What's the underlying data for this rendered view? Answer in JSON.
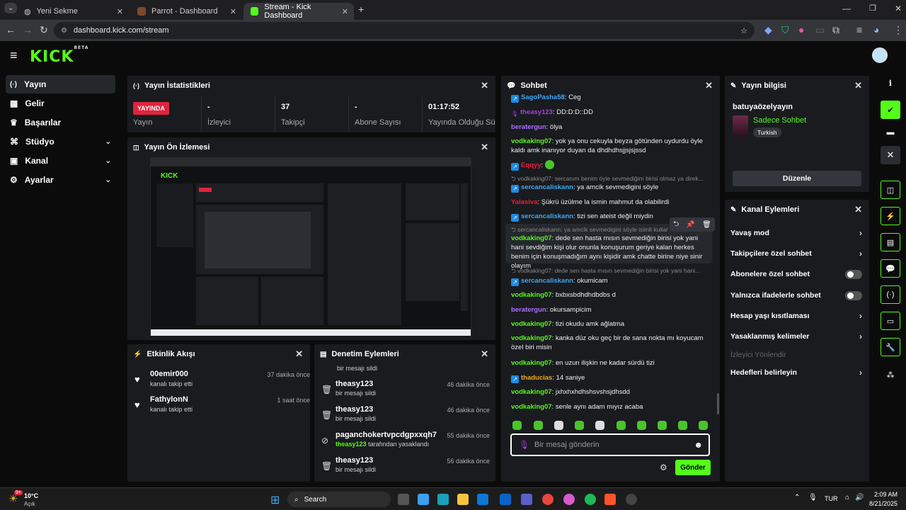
{
  "browser": {
    "tabs": [
      {
        "label": "Yeni Sekme"
      },
      {
        "label": "Parrot - Dashboard"
      },
      {
        "label": "Stream - Kick Dashboard"
      }
    ],
    "url": "dashboard.kick.com/stream"
  },
  "brand": {
    "logo": "KICK",
    "beta": "BETA",
    "accent": "#53fc18"
  },
  "sidebar": {
    "items": [
      {
        "label": "Yayın",
        "icon": "broadcast-icon"
      },
      {
        "label": "Gelir",
        "icon": "revenue-icon"
      },
      {
        "label": "Başarılar",
        "icon": "trophy-icon"
      },
      {
        "label": "Stüdyo",
        "icon": "studio-icon"
      },
      {
        "label": "Kanal",
        "icon": "channel-icon"
      },
      {
        "label": "Ayarlar",
        "icon": "gear-icon"
      }
    ]
  },
  "stats": {
    "title": "Yayın İstatistikleri",
    "live_badge": "YAYINDA",
    "cells": [
      {
        "value": "",
        "label": "Yayın"
      },
      {
        "value": "-",
        "label": "İzleyici"
      },
      {
        "value": "37",
        "label": "Takipçi"
      },
      {
        "value": "-",
        "label": "Abone Sayısı"
      },
      {
        "value": "01:17:52",
        "label": "Yayında Olduğu Süre"
      }
    ]
  },
  "preview": {
    "title": "Yayın Ön İzlemesi"
  },
  "activity": {
    "title": "Etkinlik Akışı",
    "items": [
      {
        "name": "00emir000",
        "sub": "kanalı takip etti",
        "time": "37 dakika önce"
      },
      {
        "name": "FathylonN",
        "sub": "kanalı takip etti",
        "time": "1 saat önce"
      }
    ]
  },
  "moderation": {
    "title": "Denetim Eylemleri",
    "top_sub": "bir mesajı sildi",
    "items": [
      {
        "name": "theasy123",
        "sub": "bir mesajı sildi",
        "time": "46 dakika önce",
        "icon": "trash-icon"
      },
      {
        "name": "theasy123",
        "sub": "bir mesajı sildi",
        "time": "46 dakika önce",
        "icon": "trash-icon"
      },
      {
        "name": "paganchokertvpcdgpxxqh7",
        "sub_user": "theasy123",
        "sub": "tarafından yasaklandı",
        "time": "55 dakika önce",
        "icon": "ban-icon"
      },
      {
        "name": "theasy123",
        "sub": "bir mesajı sildi",
        "time": "56 dakika önce",
        "icon": "trash-icon"
      }
    ]
  },
  "chat": {
    "title": "Sohbet",
    "messages": [
      {
        "user": "SagoPasha58",
        "color": "#3fa9f5",
        "text": "Ceg",
        "badge": "arrow"
      },
      {
        "user": "theasy123",
        "color": "#b03be8",
        "text": "DD:D:D::DD",
        "badge": "mic"
      },
      {
        "user": "beratergun",
        "color": "#a970ff",
        "text": "ölya"
      },
      {
        "user": "vodkaking07",
        "color": "#53fc18",
        "text": "yok ya onu cekuyla beyza götünden uydurdu öyle kaldı amk inanıyor duyan da dhdhdhsjjsjsjssd"
      },
      {
        "user": "Eqqyy",
        "color": "#e0243d",
        "text": "",
        "badge": "arrow"
      },
      {
        "reply": "vodkaking07: sercanım benim öyle sevmediğim birisi olmaz ya direk..."
      },
      {
        "user": "sercancaliskann",
        "color": "#3fa9f5",
        "text": "ya amcik sevmedigini söyle",
        "badge": "arrow"
      },
      {
        "user": "Yalasiva",
        "color": "#e0243d",
        "text": "Şükrü üzülme la ismin mahmut da olabilirdi"
      },
      {
        "user": "sercancaliskann",
        "color": "#3fa9f5",
        "text": "tizi sen ateist değil miydin",
        "badge": "arrow"
      },
      {
        "reply": "sercancaliskann: ya amcik sevmedigini söyle isimli kullanı..."
      },
      {
        "user": "vodkaking07",
        "color": "#53fc18",
        "text": "dede sen hasta mısın sevmediğin birisi yok yani hani sevdiğim kişi olur onunla konuşurum geriye kalan herkes benim için konuşmadığım aynı kişidir amk chatte birine niye sinir olayım"
      },
      {
        "reply": "vodkaking07: dede sen hasta mısın sevmediğin birisi yok yani hani..."
      },
      {
        "user": "sercancaliskann",
        "color": "#3fa9f5",
        "text": "okumicam",
        "badge": "arrow"
      },
      {
        "user": "vodkaking07",
        "color": "#53fc18",
        "text": "bxbxsbdhdhdbdbs d"
      },
      {
        "user": "beratergun",
        "color": "#a970ff",
        "text": "okursampicim"
      },
      {
        "user": "vodkaking07",
        "color": "#53fc18",
        "text": "tizi okudu amk ağlatma"
      },
      {
        "user": "vodkaking07",
        "color": "#53fc18",
        "text": "kanka düz oku geç bir de sana nokta mı koyucam özel biri misin"
      },
      {
        "user": "vodkaking07",
        "color": "#53fc18",
        "text": "en uzun ilişkin ne kadar sürdü tizi"
      },
      {
        "user": "thaducias",
        "color": "#f5a623",
        "text": "14 saniye",
        "badge": "arrow"
      },
      {
        "user": "vodkaking07",
        "color": "#53fc18",
        "text": "jxhxhxhdhshsvshsjdhsdd"
      },
      {
        "user": "vodkaking07",
        "color": "#53fc18",
        "text": "senle aynı adam mıyız acaba"
      }
    ],
    "placeholder": "Bir mesaj gönderin",
    "send_label": "Gönder"
  },
  "stream_info": {
    "title": "Yayın bilgisi",
    "stream_title": "batuyaözelyayın",
    "category": "Sadece Sohbet",
    "language": "Turkish",
    "edit_label": "Düzenle"
  },
  "channel_actions": {
    "title": "Kanal Eylemleri",
    "items": [
      {
        "label": "Yavaş mod",
        "control": "arrow"
      },
      {
        "label": "Takipçilere özel sohbet",
        "control": "arrow"
      },
      {
        "label": "Abonelere özel sohbet",
        "control": "toggle"
      },
      {
        "label": "Yalnızca ifadelerle sohbet",
        "control": "toggle"
      },
      {
        "label": "Hesap yaşı kısıtlaması",
        "control": "arrow"
      },
      {
        "label": "Yasaklanmış kelimeler",
        "control": "arrow"
      },
      {
        "label": "İzleyici Yönlendir",
        "control": "none",
        "disabled": true
      },
      {
        "label": "Hedefleri belirleyin",
        "control": "arrow"
      }
    ]
  },
  "taskbar": {
    "weather_temp": "10°C",
    "weather_desc": "Açık",
    "weather_badge": "9+",
    "search": "Search",
    "lang": "TUR",
    "time": "2:09 AM",
    "date": "8/21/2025"
  }
}
